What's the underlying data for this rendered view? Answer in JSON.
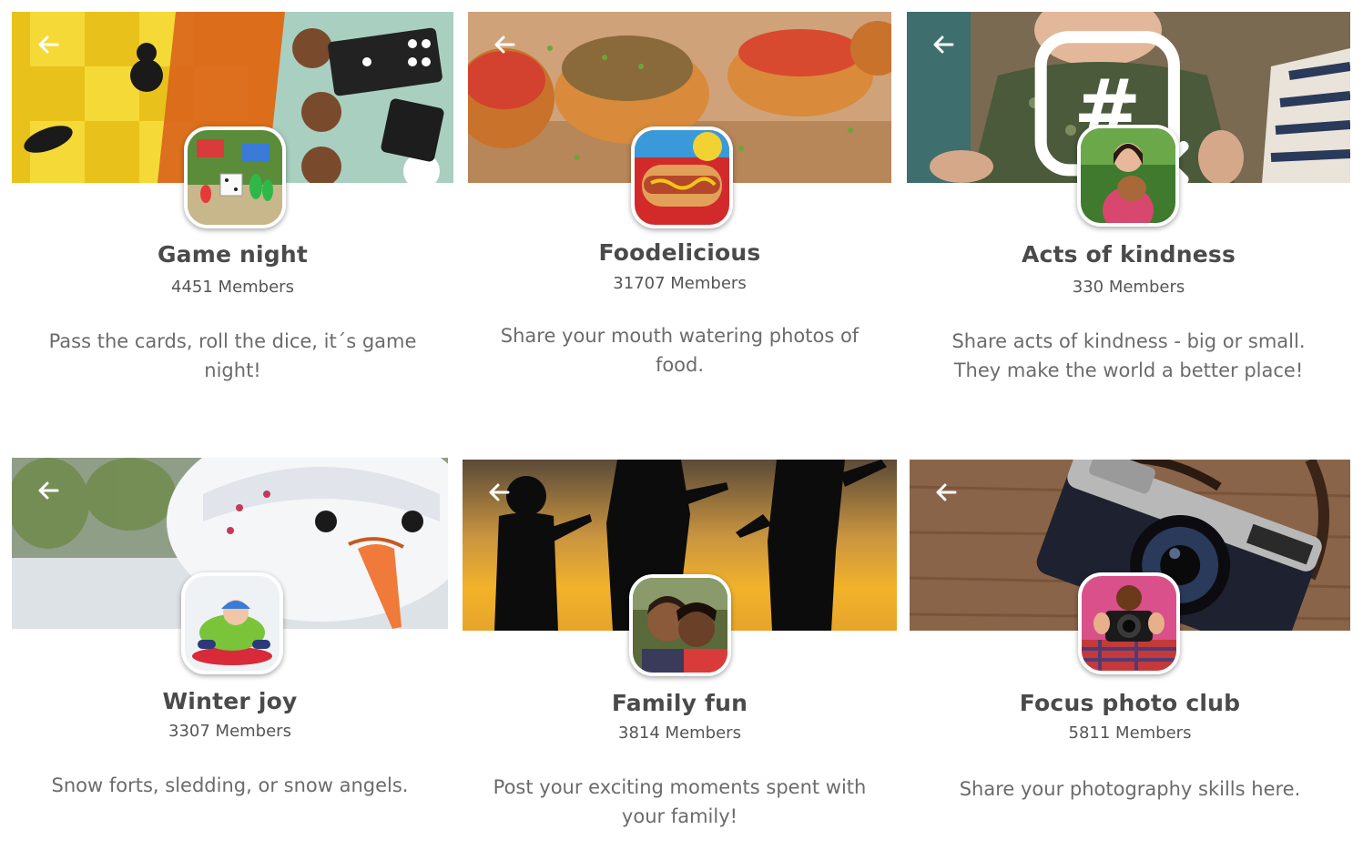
{
  "groups": [
    {
      "name": "Game night",
      "members": "4451 Members",
      "description": "Pass the cards, roll the dice, it´s game night!",
      "banner_icon": "board-game-banner",
      "avatar_icon": "board-game-avatar"
    },
    {
      "name": "Foodelicious",
      "members": "31707 Members",
      "description": "Share your mouth watering photos of food.",
      "banner_icon": "bruschetta-banner",
      "avatar_icon": "hot-dog-avatar"
    },
    {
      "name": "Acts of kindness",
      "members": "330 Members",
      "description": "Share acts of kindness - big or small. They make the world a better place!",
      "banner_icon": "grandparent-child-banner",
      "avatar_icon": "girl-with-puppy-avatar"
    },
    {
      "name": "Winter joy",
      "members": "3307 Members",
      "description": "Snow forts, sledding, or snow angels.",
      "banner_icon": "snowman-banner",
      "avatar_icon": "child-sledding-avatar"
    },
    {
      "name": "Family fun",
      "members": "3814 Members",
      "description": "Post your exciting moments spent with your family!",
      "banner_icon": "family-silhouette-sunset-banner",
      "avatar_icon": "family-selfie-avatar"
    },
    {
      "name": "Focus photo club",
      "members": "5811 Members",
      "description": "Share your photography skills here.",
      "banner_icon": "vintage-camera-banner",
      "avatar_icon": "person-with-camera-avatar"
    }
  ],
  "icons": {
    "back": "arrow-left-icon",
    "hashtag": "hashtag-close-icon"
  }
}
